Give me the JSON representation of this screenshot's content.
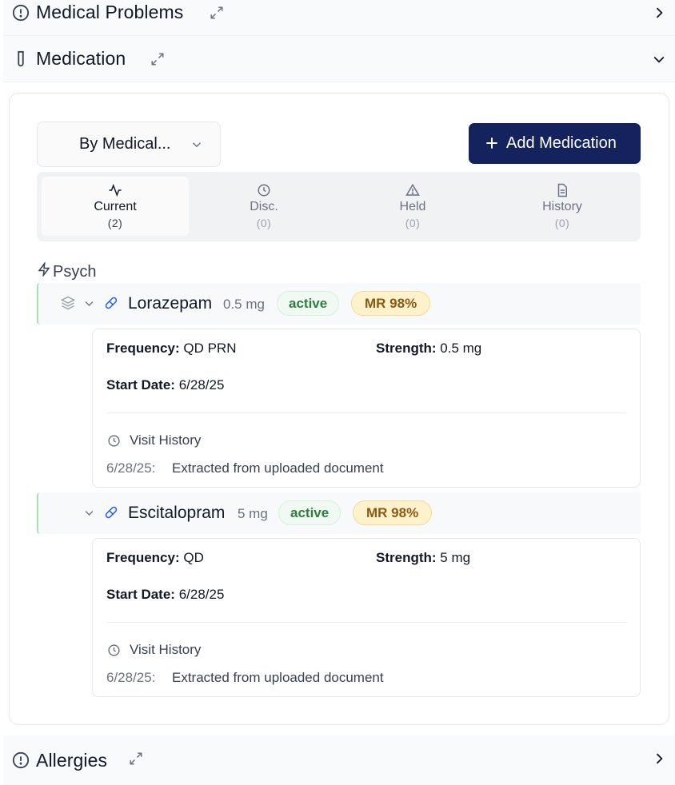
{
  "sections": {
    "medical_problems": {
      "title": "Medical Problems"
    },
    "medication": {
      "title": "Medication"
    },
    "allergies": {
      "title": "Allergies"
    }
  },
  "toolbar": {
    "group_by_value": "By Medical...",
    "add_label": "Add Medication"
  },
  "tabs": [
    {
      "label": "Current",
      "count": "(2)",
      "icon": "activity-icon"
    },
    {
      "label": "Disc.",
      "count": "(0)",
      "icon": "clock-icon"
    },
    {
      "label": "Held",
      "count": "(0)",
      "icon": "warning-icon"
    },
    {
      "label": "History",
      "count": "(0)",
      "icon": "document-icon"
    }
  ],
  "category": {
    "label": "Psych"
  },
  "medications": [
    {
      "name": "Lorazepam",
      "dose": "0.5 mg",
      "status": "active",
      "match": "MR 98%",
      "frequency_label": "Frequency:",
      "frequency": "QD PRN",
      "strength_label": "Strength:",
      "strength": "0.5 mg",
      "start_label": "Start Date:",
      "start": "6/28/25",
      "history_label": "Visit History",
      "history_date": "6/28/25:",
      "history_text": "Extracted from uploaded document"
    },
    {
      "name": "Escitalopram",
      "dose": "5 mg",
      "status": "active",
      "match": "MR 98%",
      "frequency_label": "Frequency:",
      "frequency": "QD",
      "strength_label": "Strength:",
      "strength": "5 mg",
      "start_label": "Start Date:",
      "start": "6/28/25",
      "history_label": "Visit History",
      "history_date": "6/28/25:",
      "history_text": "Extracted from uploaded document"
    }
  ],
  "colors": {
    "primary_button": "#14225e",
    "active_badge_text": "#2f7d3f",
    "match_badge_bg": "#fdf2cc",
    "row_accent": "#a7e3b2"
  }
}
